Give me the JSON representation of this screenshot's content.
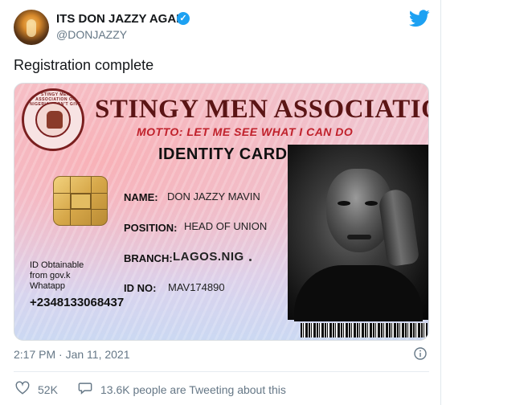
{
  "tweet": {
    "author": {
      "display_name": "ITS DON JAZZY AGAIN",
      "handle": "@DONJAZZY",
      "verified_icon": "verified-badge-icon"
    },
    "platform_icon": "twitter-bird-icon",
    "text": "Registration complete",
    "timestamp": "2:17 PM · Jan 11, 2021",
    "likes": "52K",
    "tweeting_text": "13.6K people are Tweeting about this"
  },
  "card": {
    "seal_text": "STINGY MEN ASSOCIATION OF NIGERIA · DON'T GIVE SMI SMI",
    "association": "STINGY MEN ASSOCIATION",
    "motto": "MOTTO: LET ME SEE WHAT I CAN DO",
    "title": "IDENTITY CARD",
    "fields": {
      "name_label": "NAME:",
      "name_value": "DON JAZZY MAVIN",
      "position_label": "POSITION:",
      "position_value": "HEAD OF UNION",
      "branch_label": "BRANCH:",
      "branch_value": "LAGOS.NIG",
      "id_label": "ID NO:",
      "id_value": "MAV174890"
    },
    "side_note_line1": "ID Obtainable",
    "side_note_line2": "from gov.k",
    "side_note_line3": "Whatapp",
    "phone": "+2348133068437"
  },
  "colors": {
    "twitter_blue": "#1da1f2",
    "title_red": "#5b1515",
    "motto_red": "#c0212b",
    "muted_text": "#657786"
  }
}
